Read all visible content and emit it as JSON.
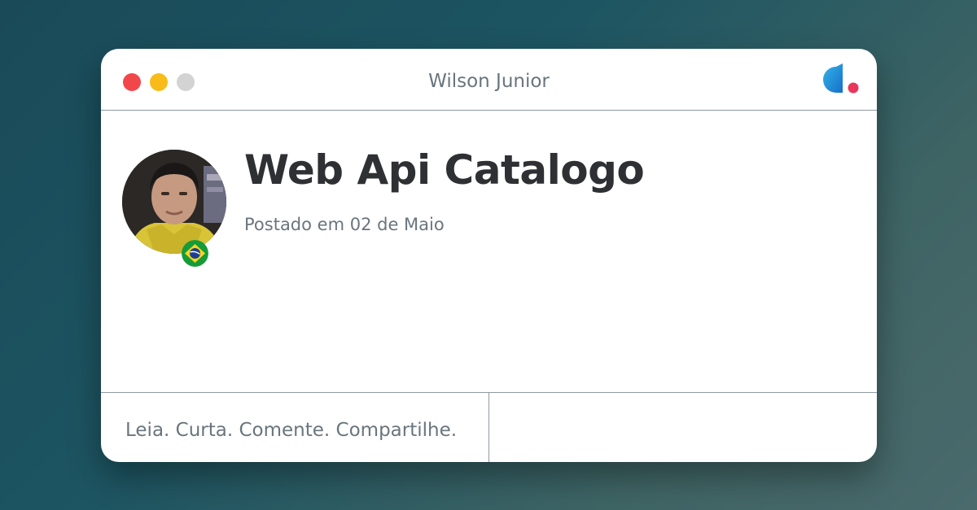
{
  "window": {
    "title": "Wilson Junior",
    "controls": [
      "close",
      "minimize",
      "maximize"
    ]
  },
  "post": {
    "title": "Web Api Catalogo",
    "date": "Postado em 02 de Maio",
    "author_flag": "brazil-flag-icon"
  },
  "footer": {
    "tagline": "Leia. Curta. Comente. Compartilhe."
  },
  "colors": {
    "close": "#f1474b",
    "minimize": "#f7bc19",
    "maximize": "#d3d3d3",
    "logo_blue": "#1b8fd6",
    "logo_dot": "#e8375a"
  }
}
